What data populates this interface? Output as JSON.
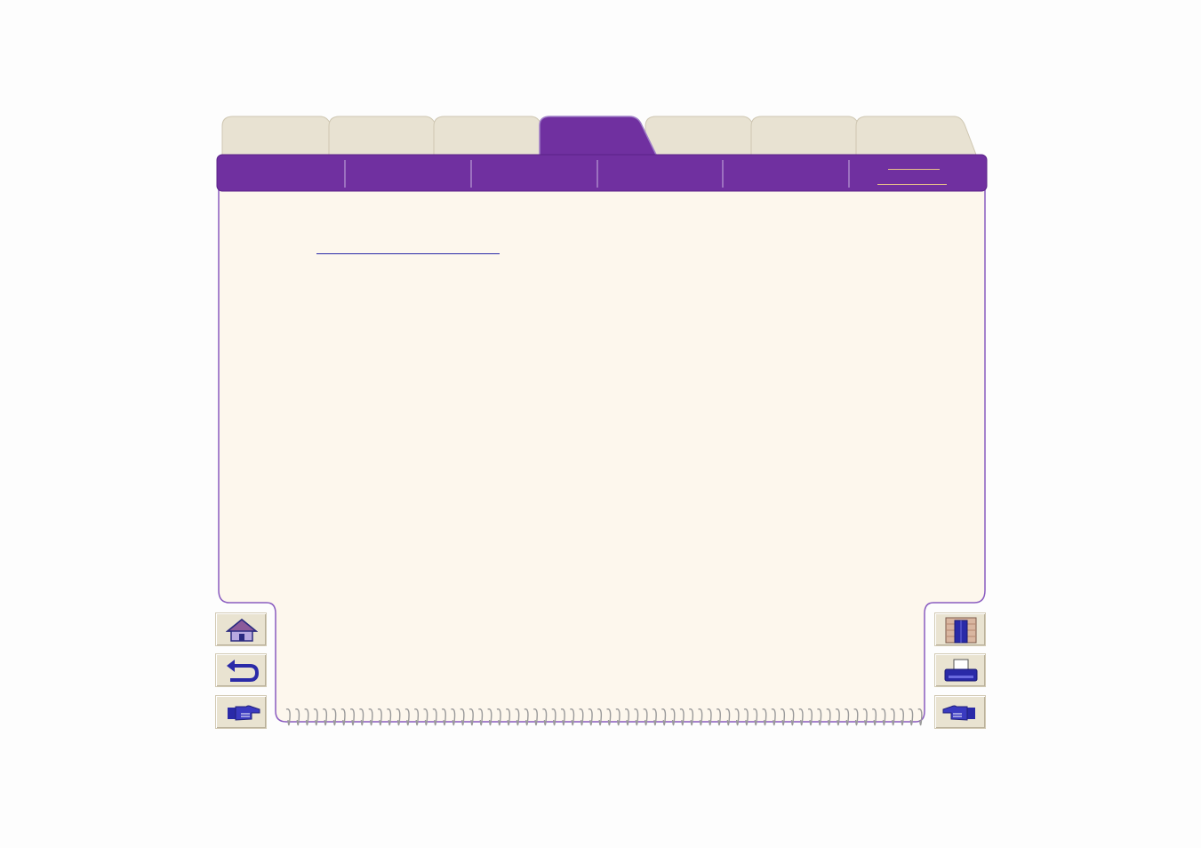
{
  "colors": {
    "accent": "#7030a0",
    "paper": "#fdf7ed",
    "tab_inactive": "#e8e2d2",
    "button_face": "#e9e3d1",
    "link": "#2a2aa8"
  },
  "tabs": [
    {
      "label": ""
    },
    {
      "label": ""
    },
    {
      "label": ""
    },
    {
      "label": "",
      "active": true
    },
    {
      "label": ""
    },
    {
      "label": ""
    },
    {
      "label": ""
    }
  ],
  "subtabs": [
    {
      "label": ""
    },
    {
      "label": ""
    },
    {
      "label": ""
    },
    {
      "label": ""
    },
    {
      "label": ""
    },
    {
      "label": "",
      "current": true
    }
  ],
  "content": {
    "link_text": ""
  },
  "nav_left": [
    {
      "icon": "home-icon"
    },
    {
      "icon": "back-arrow-icon"
    },
    {
      "icon": "pointing-hand-right-icon"
    }
  ],
  "nav_right": [
    {
      "icon": "exit-door-icon"
    },
    {
      "icon": "printer-icon"
    },
    {
      "icon": "pointing-hand-left-icon"
    }
  ]
}
